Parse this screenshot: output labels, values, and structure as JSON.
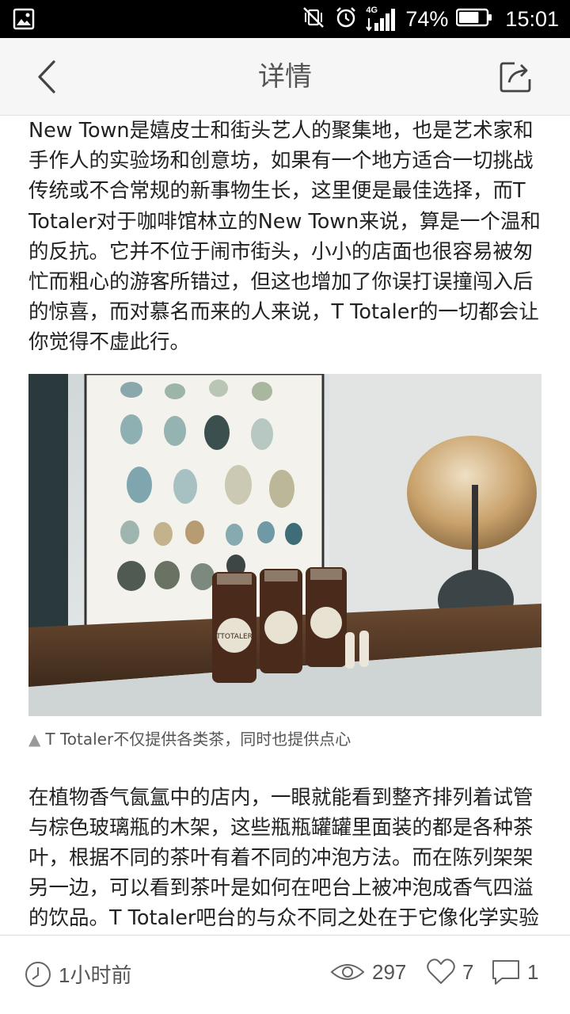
{
  "status_bar": {
    "network": "4G",
    "battery_percent": "74%",
    "battery_level": 0.74,
    "time": "15:01"
  },
  "nav": {
    "title": "详情"
  },
  "article": {
    "paragraph1": "New Town是嬉皮士和街头艺人的聚集地，也是艺术家和手作人的实验场和创意坊，如果有一个地方适合一切挑战传统或不合常规的新事物生长，这里便是最佳选择，而T Totaler对于咖啡馆林立的New Town来说，算是一个温和的反抗。它并不位于闹市街头，小小的店面也很容易被匆忙而粗心的游客所错过，但这也增加了你误打误撞闯入后的惊喜，而对慕名而来的人来说，T Totaler的一切都会让你觉得不虚此行。",
    "image_label": "TTOTALER",
    "caption_mark": "▲",
    "caption": "T Totaler不仅提供各类茶，同时也提供点心",
    "paragraph2": "在植物香气氤氲中的店内，一眼就能看到整齐排列着试管与棕色玻璃瓶的木架，这些瓶瓶罐罐里面装的都是各种茶叶，根据不同的茶叶有着不同的冲泡方法。而在陈列架架另一边，可以看到茶叶是如何在吧台上被冲泡成香气四溢的饮品。T Totaler吧台的与众不同之处在于它像化学实验台一样上面摆放着烧杯，量"
  },
  "footer": {
    "posted": "1小时前",
    "views": "297",
    "likes": "7",
    "comments": "1"
  },
  "colors": {
    "status_bg": "#000000",
    "nav_bg": "#f6f6f6",
    "text": "#222222",
    "muted": "#555555"
  }
}
